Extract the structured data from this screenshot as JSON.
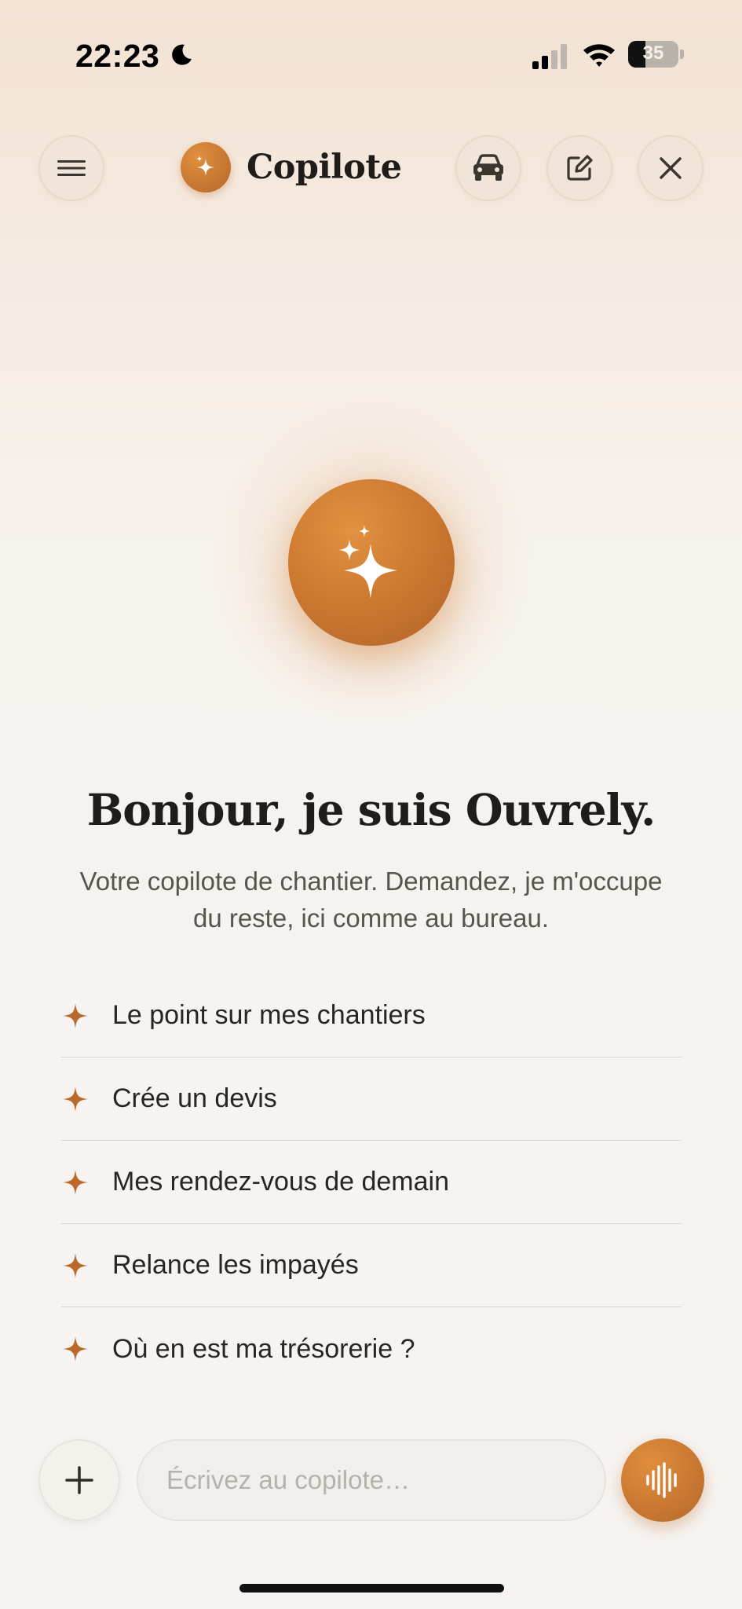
{
  "status_bar": {
    "time": "22:23",
    "battery_percent": "35",
    "battery_level": 0.35,
    "icons": [
      "moon-icon",
      "signal-icon",
      "wifi-icon",
      "battery-icon"
    ]
  },
  "header": {
    "brand_name": "Copilote",
    "buttons": [
      "menu-icon",
      "car-icon",
      "edit-icon",
      "close-icon"
    ]
  },
  "hero": {
    "title": "Bonjour, je suis Ouvrely.",
    "subtitle": "Votre copilote de chantier. Demandez, je m'occupe du reste, ici comme au bureau."
  },
  "suggestions": [
    {
      "label": "Le point sur mes chantiers"
    },
    {
      "label": "Crée un devis"
    },
    {
      "label": "Mes rendez-vous de demain"
    },
    {
      "label": "Relance les impayés"
    },
    {
      "label": "Où en est ma trésorerie ?"
    }
  ],
  "composer": {
    "placeholder": "Écrivez au copilote…",
    "value": ""
  },
  "colors": {
    "accent": "#c97a33",
    "accent_dark": "#b0622a",
    "text": "#1f1c19",
    "muted": "#5a544e",
    "placeholder": "#b7b1ab"
  }
}
